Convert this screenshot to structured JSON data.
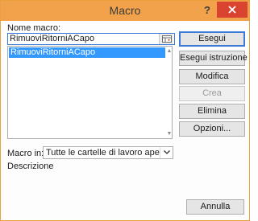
{
  "window": {
    "title": "Macro",
    "help_label": "?",
    "accent_color": "#f2a24a",
    "close_color": "#d9432f"
  },
  "macro_name": {
    "label": "Nome macro:",
    "value": "RimuoviRitorniACapo"
  },
  "macro_list": {
    "items": [
      "RimuoviRitorniACapo"
    ],
    "selected_index": 0
  },
  "buttons": {
    "run": "Esegui",
    "step_into": "Esegui istruzione",
    "edit": "Modifica",
    "create": "Crea",
    "delete": "Elimina",
    "options": "Opzioni...",
    "cancel": "Annulla"
  },
  "macros_in": {
    "label": "Macro in:",
    "value": "Tutte le cartelle di lavoro aperte"
  },
  "description": {
    "label": "Descrizione",
    "value": ""
  }
}
